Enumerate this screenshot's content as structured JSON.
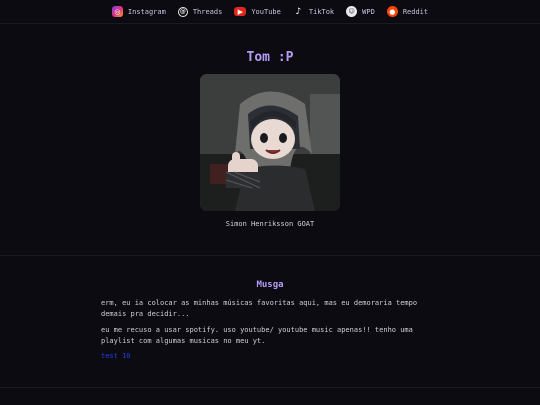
{
  "nav": {
    "items": [
      {
        "label": "Instagram",
        "icon": "instagram-icon"
      },
      {
        "label": "Threads",
        "icon": "threads-icon"
      },
      {
        "label": "YouTube",
        "icon": "youtube-icon"
      },
      {
        "label": "TikTok",
        "icon": "tiktok-icon"
      },
      {
        "label": "WPD",
        "icon": "wpd-icon"
      },
      {
        "label": "Reddit",
        "icon": "reddit-icon"
      }
    ]
  },
  "profile": {
    "name": "Tom :P",
    "avatar_caption": "Simon Henriksson GOAT"
  },
  "music": {
    "title": "Musga",
    "paragraph1": "erm, eu ia colocar as minhas músicas favoritas aqui, mas eu demoraria tempo demais pra decidir...",
    "paragraph2": "eu me recuso a usar spotify. uso youtube/ youtube music apenas!! tenho uma playlist com algumas musicas no meu yt.",
    "link_label": "test 10"
  },
  "colors": {
    "background": "#0c0b12",
    "accent": "#b49cf6",
    "link": "#1f3fd8"
  }
}
